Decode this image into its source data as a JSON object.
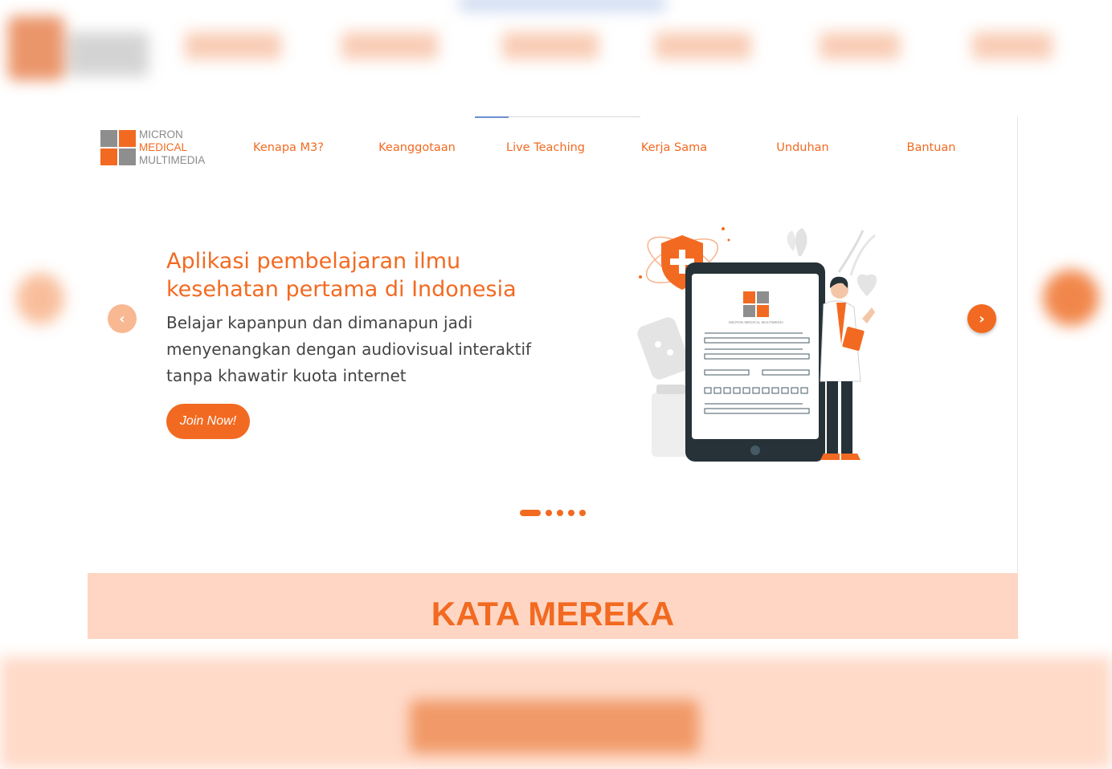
{
  "logo": {
    "line1": "MICRON",
    "line2": "MEDICAL",
    "line3": "MULTIMEDIA",
    "illustration_label": "MICRON MEDICAL MULTIMEDIA"
  },
  "nav": {
    "items": [
      {
        "label": "Kenapa M3?"
      },
      {
        "label": "Keanggotaan"
      },
      {
        "label": "Live Teaching"
      },
      {
        "label": "Kerja Sama"
      },
      {
        "label": "Unduhan"
      },
      {
        "label": "Bantuan"
      }
    ]
  },
  "hero": {
    "title": "Aplikasi pembelajaran ilmu kesehatan pertama di Indonesia",
    "subtitle": "Belajar kapanpun dan dimanapun jadi menyenangkan dengan audiovisual interaktif tanpa khawatir kuota internet",
    "cta_label": "Join Now!",
    "prev_icon": "chevron-left-icon",
    "next_icon": "chevron-right-icon"
  },
  "carousel": {
    "slide_count": 5,
    "active_index": 0
  },
  "testimonials": {
    "title": "KATA MEREKA"
  },
  "colors": {
    "accent": "#f26a21",
    "accent_light": "#f8b892",
    "section_bg": "#ffd6c3",
    "text": "#444444",
    "gray": "#8e8e8e"
  }
}
